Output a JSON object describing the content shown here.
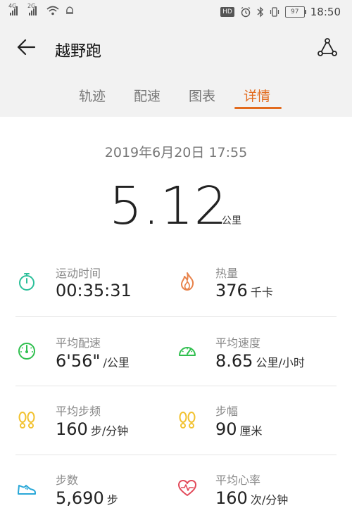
{
  "status_bar": {
    "net1": "4G",
    "net2": "2G",
    "hd": "HD",
    "battery": "97",
    "time": "18:50"
  },
  "header": {
    "title": "越野跑",
    "tabs": [
      {
        "label": "轨迹"
      },
      {
        "label": "配速"
      },
      {
        "label": "图表"
      },
      {
        "label": "详情"
      }
    ],
    "active_tab": "详情"
  },
  "summary": {
    "date": "2019年6月20日 17:55",
    "distance": "5.12",
    "distance_unit": "公里"
  },
  "stats": [
    {
      "icon": "stopwatch-icon",
      "color": "#2bbf9a",
      "label": "运动时间",
      "value": "00:35:31",
      "unit": ""
    },
    {
      "icon": "flame-icon",
      "color": "#e8824a",
      "label": "热量",
      "value": "376",
      "unit": "千卡"
    },
    {
      "icon": "speedometer-icon",
      "color": "#2fbf4e",
      "label": "平均配速",
      "value": "6'56\"",
      "unit": "/公里"
    },
    {
      "icon": "gauge-icon",
      "color": "#2fbf4e",
      "label": "平均速度",
      "value": "8.65",
      "unit": "公里/小时"
    },
    {
      "icon": "footprints-icon",
      "color": "#f2c230",
      "label": "平均步频",
      "value": "160",
      "unit": "步/分钟"
    },
    {
      "icon": "footprints-icon",
      "color": "#f2c230",
      "label": "步幅",
      "value": "90",
      "unit": "厘米"
    },
    {
      "icon": "sneaker-icon",
      "color": "#2aa8d8",
      "label": "步数",
      "value": "5,690",
      "unit": "步"
    },
    {
      "icon": "heart-rate-icon",
      "color": "#e24a5a",
      "label": "平均心率",
      "value": "160",
      "unit": "次/分钟"
    }
  ]
}
